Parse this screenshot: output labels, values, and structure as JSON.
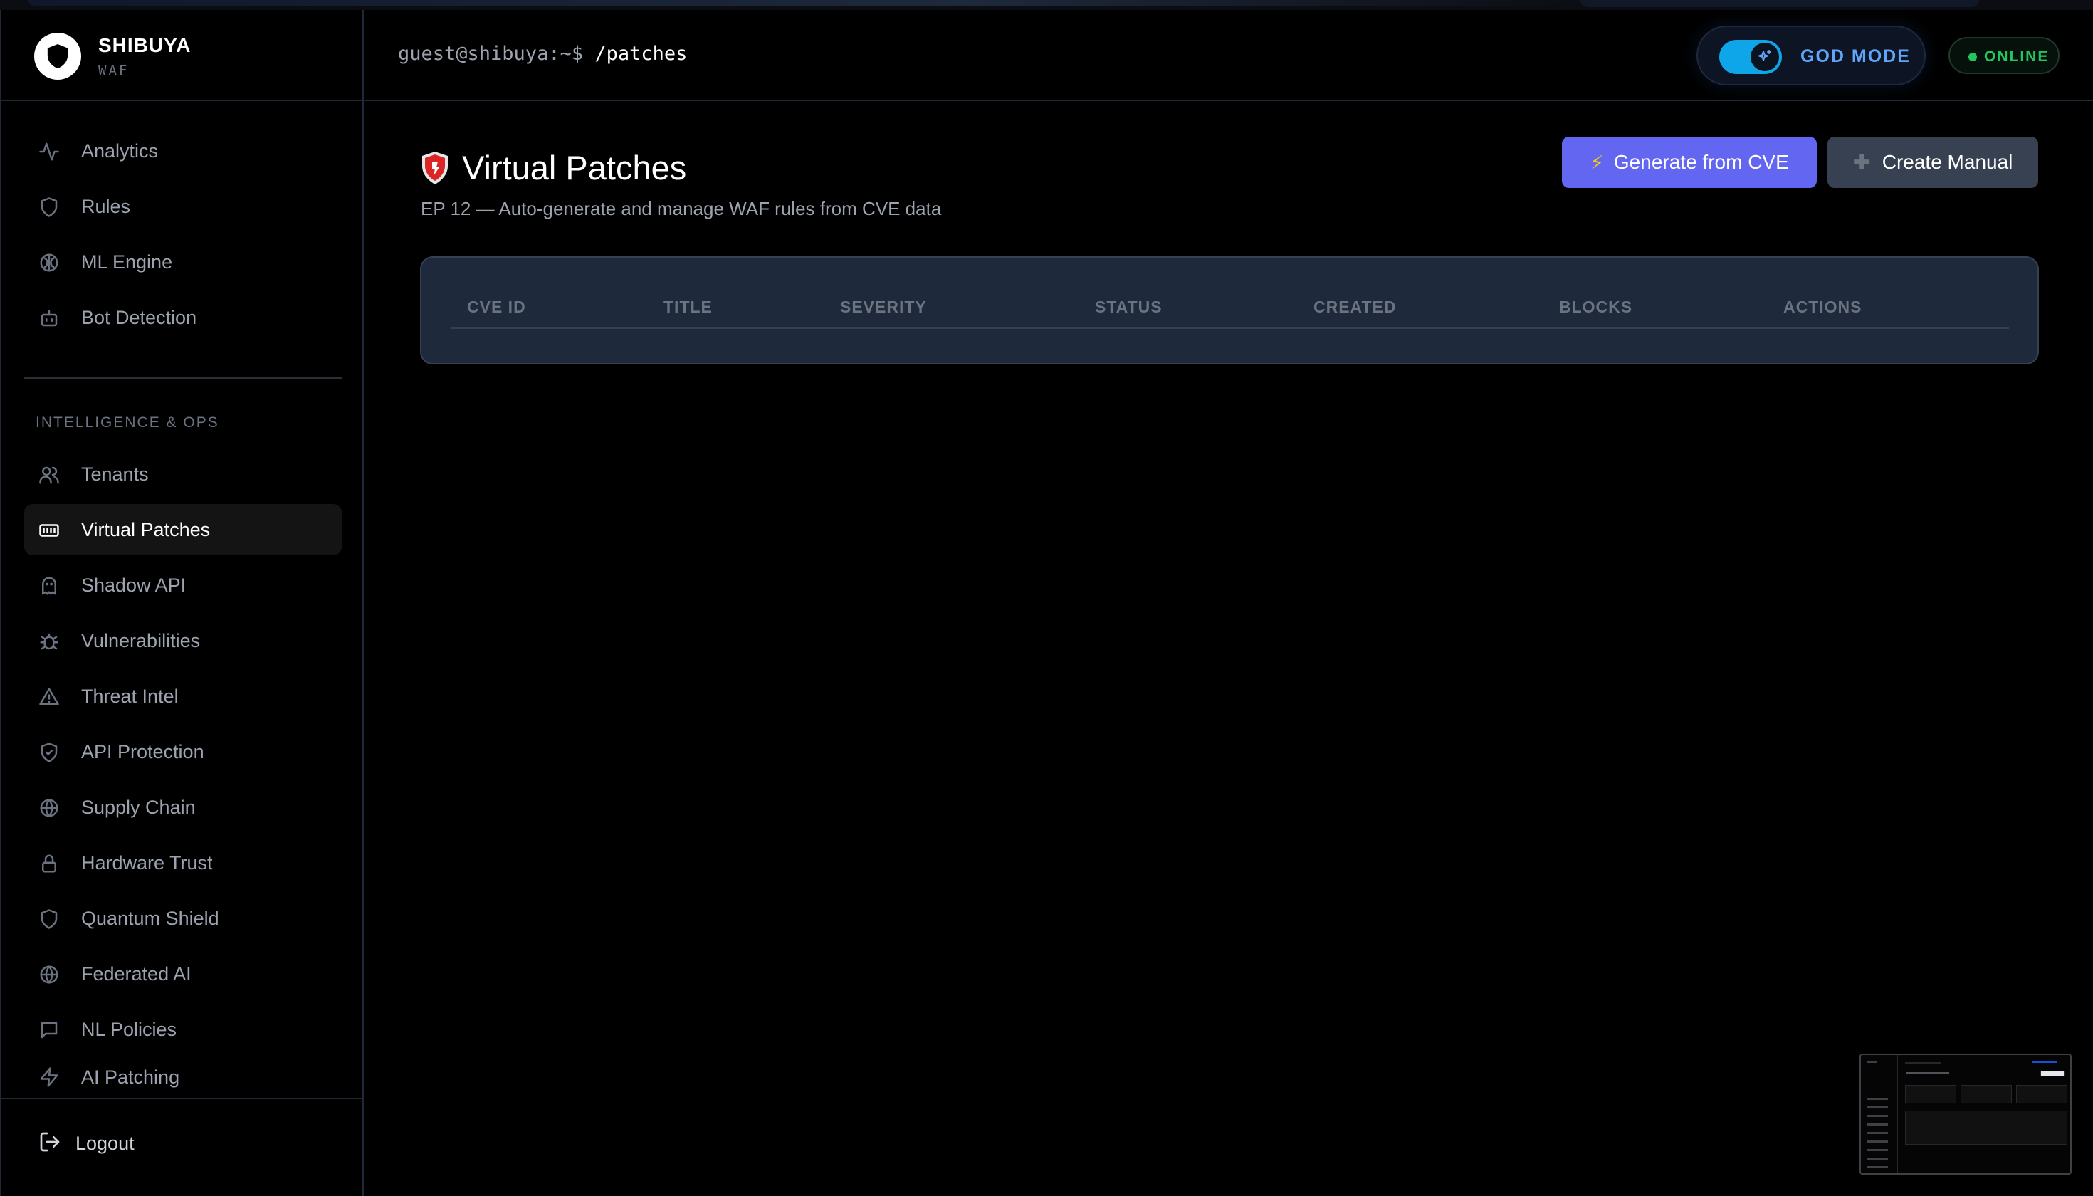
{
  "brand": {
    "name": "SHIBUYA",
    "sub": "WAF"
  },
  "header": {
    "prompt_host": "guest@shibuya:~$",
    "prompt_path": "/patches",
    "god_mode_label": "GOD MODE",
    "status_label": "ONLINE"
  },
  "sidebar": {
    "items_top": [
      {
        "label": "Analytics",
        "icon": "activity-icon"
      },
      {
        "label": "Rules",
        "icon": "shield-icon"
      },
      {
        "label": "ML Engine",
        "icon": "brain-icon"
      },
      {
        "label": "Bot Detection",
        "icon": "bot-icon"
      }
    ],
    "section_label": "INTELLIGENCE & OPS",
    "items_ops": [
      {
        "label": "Tenants",
        "icon": "users-icon"
      },
      {
        "label": "Virtual Patches",
        "icon": "patch-icon",
        "active": true
      },
      {
        "label": "Shadow API",
        "icon": "ghost-icon"
      },
      {
        "label": "Vulnerabilities",
        "icon": "bug-icon"
      },
      {
        "label": "Threat Intel",
        "icon": "alert-triangle-icon"
      },
      {
        "label": "API Protection",
        "icon": "shield-check-icon"
      },
      {
        "label": "Supply Chain",
        "icon": "globe-icon"
      },
      {
        "label": "Hardware Trust",
        "icon": "lock-icon"
      },
      {
        "label": "Quantum Shield",
        "icon": "shield-icon"
      },
      {
        "label": "Federated AI",
        "icon": "globe-icon"
      },
      {
        "label": "NL Policies",
        "icon": "message-icon"
      },
      {
        "label": "AI Patching",
        "icon": "zap-icon"
      }
    ],
    "logout_label": "Logout"
  },
  "main": {
    "title": "Virtual Patches",
    "subtitle": "EP 12 — Auto-generate and manage WAF rules from CVE data",
    "generate_button": "Generate from CVE",
    "create_button": "Create Manual",
    "table": {
      "columns": [
        "CVE ID",
        "TITLE",
        "SEVERITY",
        "STATUS",
        "CREATED",
        "BLOCKS",
        "ACTIONS"
      ],
      "rows": []
    }
  },
  "colors": {
    "accent": "#6366f1",
    "online": "#22c55e",
    "godmode": "#60a5fa",
    "toggle": "#0ea5e9"
  }
}
